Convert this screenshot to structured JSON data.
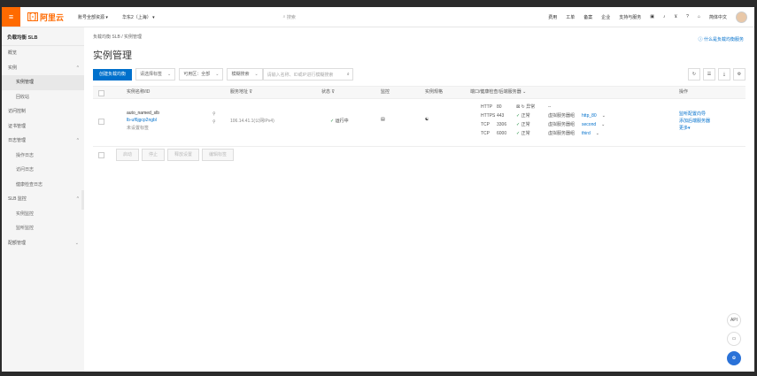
{
  "topbar": {
    "menu_icon": "menu-icon",
    "logo_text": "阿里云",
    "logo_mark": "[-]",
    "workspace": "账号全部资源",
    "region": "华东2（上海）",
    "search_placeholder": "搜索",
    "links": [
      "费用",
      "工单",
      "备案",
      "企业",
      "支持与服务"
    ],
    "lang": "简体中文"
  },
  "sidebar": {
    "title": "负载均衡 SLB",
    "items": [
      {
        "label": "概览",
        "sub": false
      },
      {
        "label": "实例",
        "sub": false,
        "chev": "^"
      },
      {
        "label": "实例管理",
        "sub": true,
        "active": true
      },
      {
        "label": "回收站",
        "sub": true
      },
      {
        "label": "访问控制",
        "sub": false
      },
      {
        "label": "证书管理",
        "sub": false
      },
      {
        "label": "日志管理",
        "sub": false,
        "chev": "^"
      },
      {
        "label": "操作日志",
        "sub": true
      },
      {
        "label": "访问日志",
        "sub": true
      },
      {
        "label": "健康检查日志",
        "sub": true
      },
      {
        "label": "SLB 监控",
        "sub": false,
        "chev": "^"
      },
      {
        "label": "实例监控",
        "sub": true
      },
      {
        "label": "监听监控",
        "sub": true
      },
      {
        "label": "配额管理",
        "sub": false,
        "chev": "v"
      }
    ]
  },
  "main": {
    "breadcrumb": "负载均衡 SLB / 实例管理",
    "help_link": "什么是负载均衡服务",
    "title": "实例管理",
    "create_button": "创建负载均衡",
    "filter_select": "请选择标签",
    "region_filter": "可用区：全部",
    "fuzzy_select": "模糊搜索",
    "search_placeholder": "请输入名称、ID或IP进行模糊搜索",
    "columns": [
      "实例名称/ID",
      "服务地址",
      "状态",
      "监控",
      "端口/健康检查/后端服务器",
      "实例规格",
      "操作"
    ],
    "row": {
      "name": "auto_named_slb",
      "id": "lb-uf6jgcp2ngbl",
      "tag": "未设置标签",
      "address": "106.14.41.1(公网IPv4)",
      "status": "运行中",
      "listeners": [
        {
          "proto": "HTTP",
          "port": "80",
          "health": "异常",
          "backend": "--"
        },
        {
          "proto": "HTTPS",
          "port": "443",
          "health": "正常",
          "backend": "虚拟服务器组"
        },
        {
          "proto": "TCP",
          "port": "3306",
          "health": "正常",
          "backend": "虚拟服务器组"
        },
        {
          "proto": "TCP",
          "port": "6000",
          "health": "正常",
          "backend": "虚拟服务器组"
        }
      ],
      "backend_names": [
        "http_80",
        "second",
        "third"
      ],
      "actions": [
        "监听配置向导",
        "添加后端服务器",
        "更多"
      ]
    },
    "bulk_actions": [
      "启动",
      "停止",
      "释放设置",
      "编辑标签"
    ]
  },
  "floats": [
    "API",
    "doc-icon",
    "chat-icon"
  ]
}
